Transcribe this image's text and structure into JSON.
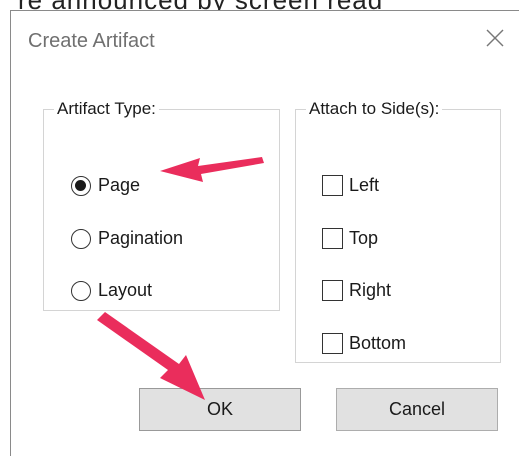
{
  "background_text": "re announced by screen read",
  "dialog": {
    "title": "Create Artifact",
    "close_icon": "close-icon"
  },
  "artifact_type": {
    "legend": "Artifact Type:",
    "options": [
      {
        "label": "Page",
        "selected": true
      },
      {
        "label": "Pagination",
        "selected": false
      },
      {
        "label": "Layout",
        "selected": false
      }
    ]
  },
  "attach_sides": {
    "legend": "Attach to Side(s):",
    "options": [
      {
        "label": "Left",
        "checked": false
      },
      {
        "label": "Top",
        "checked": false
      },
      {
        "label": "Right",
        "checked": false
      },
      {
        "label": "Bottom",
        "checked": false
      }
    ]
  },
  "buttons": {
    "ok": "OK",
    "cancel": "Cancel"
  },
  "annotations": {
    "arrow_color": "#ea2d5c"
  }
}
